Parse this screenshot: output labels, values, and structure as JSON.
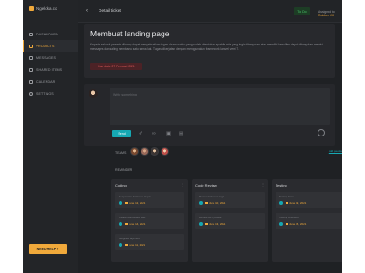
{
  "sidebar": {
    "brand": "Ngeloka.co",
    "items": [
      {
        "label": "DASHBOARD",
        "icon": "dashboard-icon",
        "active": false
      },
      {
        "label": "PROJECTS",
        "icon": "projects-icon",
        "active": true
      },
      {
        "label": "MESSAGES",
        "icon": "messages-icon",
        "active": false
      },
      {
        "label": "SHARED ITEMS",
        "icon": "shared-icon",
        "active": false
      },
      {
        "label": "CALENDAR",
        "icon": "calendar-icon",
        "active": false
      },
      {
        "label": "SETTINGS",
        "icon": "gear-icon",
        "active": false
      }
    ],
    "help_label": "NEED HELP ?"
  },
  "header": {
    "back_icon": "chevron-left-icon",
    "title": "Detail ticket",
    "status": "To Do",
    "assigned_prefix": "Assigned to",
    "assigned_name": "Robbert JK"
  },
  "ticket": {
    "title": "Membuat landing page",
    "description": "Kepada seluruh peserta diharap dapat menyelesaikan tugas dalam waktu yang sudah ditentukan apabila ada yang ingin ditanyakan atau memiliki kesulitan dapat ditanyakan melalui messages dan saling membantu satu sama lain. Tugas dikerjakan dengan menggunakan framework laravel versi 7.",
    "due": "Due date: 27 Februari 2021"
  },
  "comment": {
    "placeholder": "Write something",
    "send_label": "Send"
  },
  "teams": {
    "label": "TEAMS",
    "add_label": "Add people",
    "members": [
      "member-1",
      "member-2",
      "member-3",
      "member-4"
    ]
  },
  "reminder": {
    "label": "REMINDER",
    "boards": [
      {
        "title": "Coding",
        "tasks": [
          {
            "text": "Responsive halaman depan",
            "date": "June 12, 2021"
          },
          {
            "text": "Create dashboard user",
            "date": "June 14, 2021"
          },
          {
            "text": "Integrasi payment",
            "date": "June 11, 2021"
          }
        ]
      },
      {
        "title": "Code Review",
        "tasks": [
          {
            "text": "Review halaman login",
            "date": "June 10, 2021"
          },
          {
            "text": "Review API produk",
            "date": "June 13, 2021"
          }
        ]
      },
      {
        "title": "Testing",
        "tasks": [
          {
            "text": "Testing form",
            "date": "June 09, 2021"
          },
          {
            "text": "Testing checkout",
            "date": "June 15, 2021"
          }
        ]
      }
    ]
  },
  "colors": {
    "accent": "#f0a93b",
    "primary": "#16a8b3",
    "status_green": "#49c46a",
    "danger": "#e05b5b"
  }
}
